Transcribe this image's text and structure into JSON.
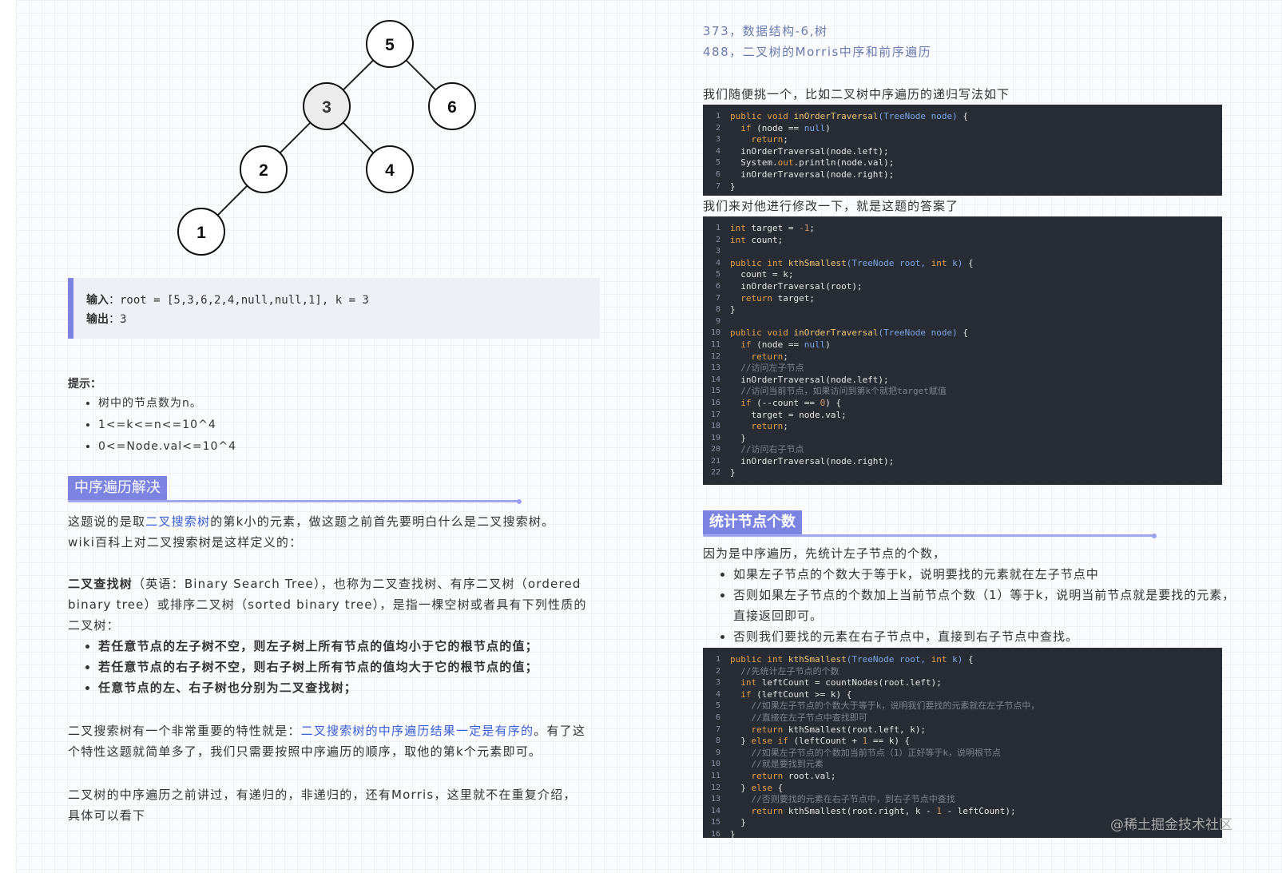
{
  "tree": {
    "nodes": [
      "5",
      "3",
      "6",
      "2",
      "4",
      "1"
    ]
  },
  "example": {
    "input_label": "输入",
    "input_value": "：root = [5,3,6,2,4,null,null,1], k = 3",
    "output_label": "输出",
    "output_value": "：3"
  },
  "hints": {
    "title": "提示：",
    "items": [
      "树中的节点数为n。",
      "1<=k<=n<=10^4",
      "0<=Node.val<=10^4"
    ]
  },
  "section1": {
    "heading": "中序遍历解决",
    "p1_before": "这题说的是取",
    "p1_link": "二叉搜索树",
    "p1_after": "的第k小的元素，做这题之前首先要明白什么是二叉搜索树。",
    "p1_line2": "wiki百科上对二叉搜索树是这样定义的：",
    "def_bold": "二叉查找树",
    "def_rest": "（英语：Binary Search Tree），也称为二叉查找树、有序二叉树（ordered binary tree）或排序二叉树（sorted binary tree），是指一棵空树或者具有下列性质的二叉树：",
    "props": [
      "若任意节点的左子树不空，则左子树上所有节点的值均小于它的根节点的值；",
      "若任意节点的右子树不空，则右子树上所有节点的值均大于它的根节点的值；",
      "任意节点的左、右子树也分别为二叉查找树；"
    ],
    "p3_before": "二叉搜索树有一个非常重要的特性就是：",
    "p3_link": "二叉搜索树的中序遍历结果一定是有序的",
    "p3_after": "。有了这个特性这题就简单多了，我们只需要按照中序遍历的顺序，取他的第k个元素即可。",
    "p4": "二叉树的中序遍历之前讲过，有递归的，非递归的，还有Morris，这里就不在重复介绍，具体可以看下"
  },
  "refs": [
    "373，数据结构-6,树",
    "488，二叉树的Morris中序和前序遍历"
  ],
  "right_text1": "我们随便挑一个，比如二叉树中序遍历的递归写法如下",
  "right_text2": "我们来对他进行修改一下，就是这题的答案了",
  "section2": {
    "heading": "统计节点个数",
    "intro": "因为是中序遍历，先统计左子节点的个数，",
    "items": [
      "如果左子节点的个数大于等于k，说明要找的元素就在左子节点中",
      "否则如果左子节点的个数加上当前节点个数（1）等于k，说明当前节点就是要找的元素，直接返回即可。",
      "否则我们要找的元素在右子节点中，直接到右子节点中查找。"
    ]
  },
  "watermark": "@稀土掘金技术社区"
}
